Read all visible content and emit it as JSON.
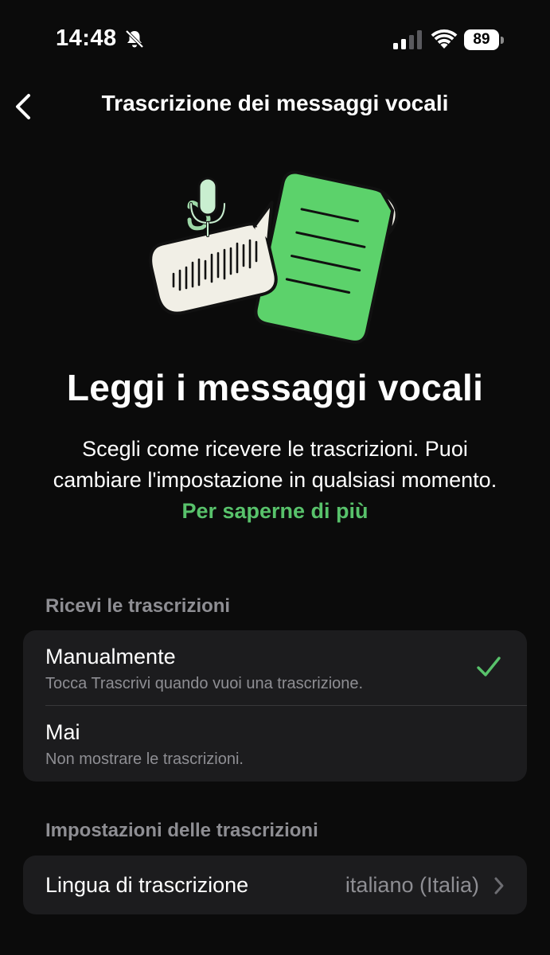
{
  "status_bar": {
    "time": "14:48",
    "battery": "89",
    "icons": [
      "bell-off-icon",
      "signal-icon",
      "wifi-icon",
      "battery-icon"
    ]
  },
  "nav": {
    "back_icon": "chevron-left-icon",
    "title": "Trascrizione dei messaggi vocali"
  },
  "hero": {
    "title": "Leggi i messaggi vocali",
    "description": "Scegli come ricevere le trascrizioni. Puoi cambiare l'impostazione in qualsiasi momento. ",
    "link": "Per saperne di più",
    "illustration": "voice-to-text-illustration"
  },
  "receive_section": {
    "header": "Ricevi le trascrizioni",
    "options": [
      {
        "title": "Manualmente",
        "subtitle": "Tocca Trascrivi quando vuoi una trascrizione.",
        "selected": true
      },
      {
        "title": "Mai",
        "subtitle": "Non mostrare le trascrizioni.",
        "selected": false
      }
    ]
  },
  "settings_section": {
    "header": "Impostazioni delle trascrizioni",
    "language_label": "Lingua di trascrizione",
    "language_value": "italiano (Italia)"
  },
  "colors": {
    "background": "#0b0b0b",
    "card": "#1c1c1e",
    "accent_green": "#58c26b",
    "secondary_text": "#8e8e93"
  }
}
